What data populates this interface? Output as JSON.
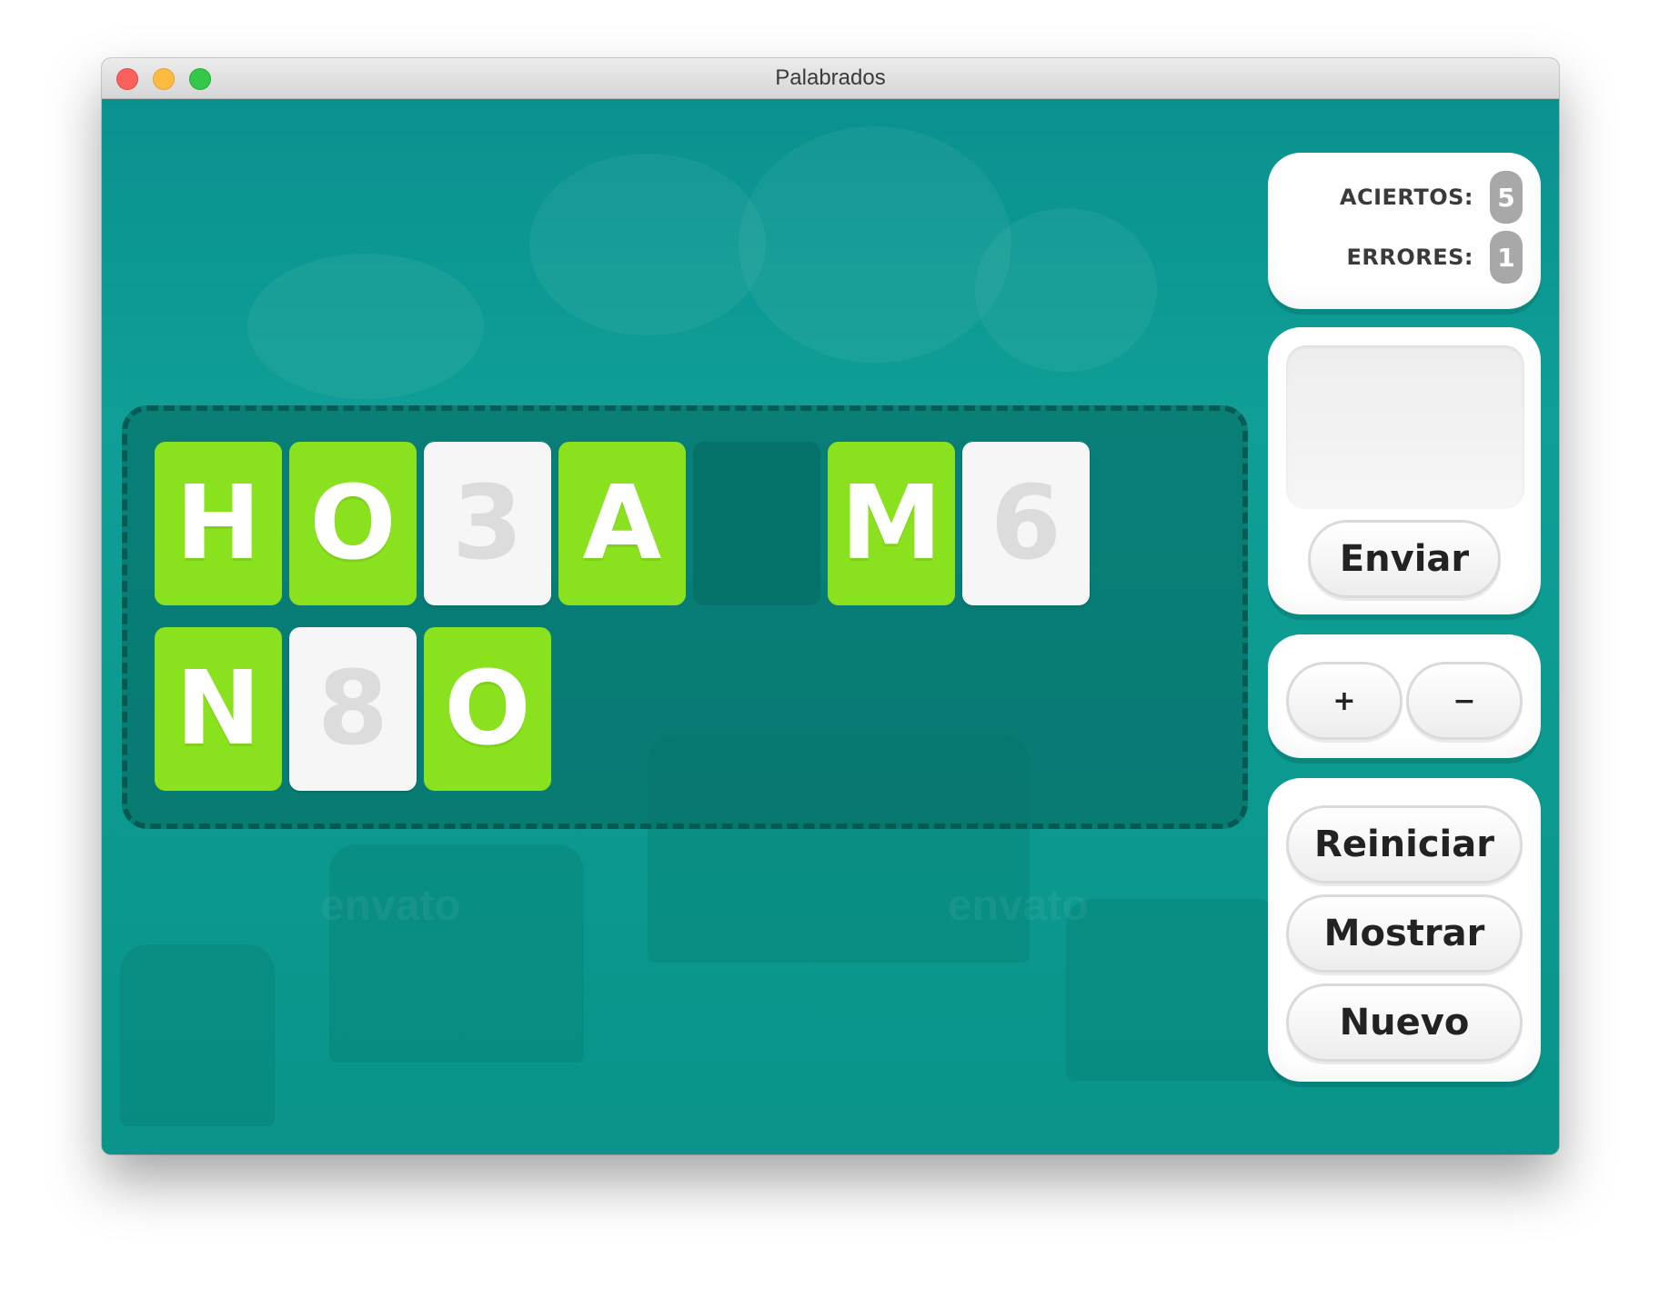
{
  "window": {
    "title": "Palabrados"
  },
  "board": {
    "rows": [
      [
        {
          "letter": "H",
          "state": "green"
        },
        {
          "letter": "O",
          "state": "green"
        },
        {
          "letter": "3",
          "state": "white"
        },
        {
          "letter": "A",
          "state": "green"
        },
        {
          "letter": "",
          "state": "empty"
        },
        {
          "letter": "M",
          "state": "green"
        },
        {
          "letter": "6",
          "state": "white"
        }
      ],
      [
        {
          "letter": "N",
          "state": "green"
        },
        {
          "letter": "8",
          "state": "white"
        },
        {
          "letter": "O",
          "state": "green"
        }
      ]
    ]
  },
  "score": {
    "aciertos_label": "ACIERTOS:",
    "aciertos_value": "5",
    "errores_label": "ERRORES:",
    "errores_value": "1"
  },
  "answer": {
    "input_value": "",
    "send_label": "Enviar"
  },
  "zoom": {
    "plus_label": "+",
    "minus_label": "−"
  },
  "actions": {
    "restart_label": "Reiniciar",
    "show_label": "Mostrar",
    "new_label": "Nuevo"
  },
  "background": {
    "watermark_left": "envato",
    "watermark_right": "envato"
  },
  "colors": {
    "game_bg": "#0b9590",
    "tile_green": "#8ae21e",
    "tile_white": "#f6f6f6",
    "badge_gray": "#a8a8a8"
  }
}
